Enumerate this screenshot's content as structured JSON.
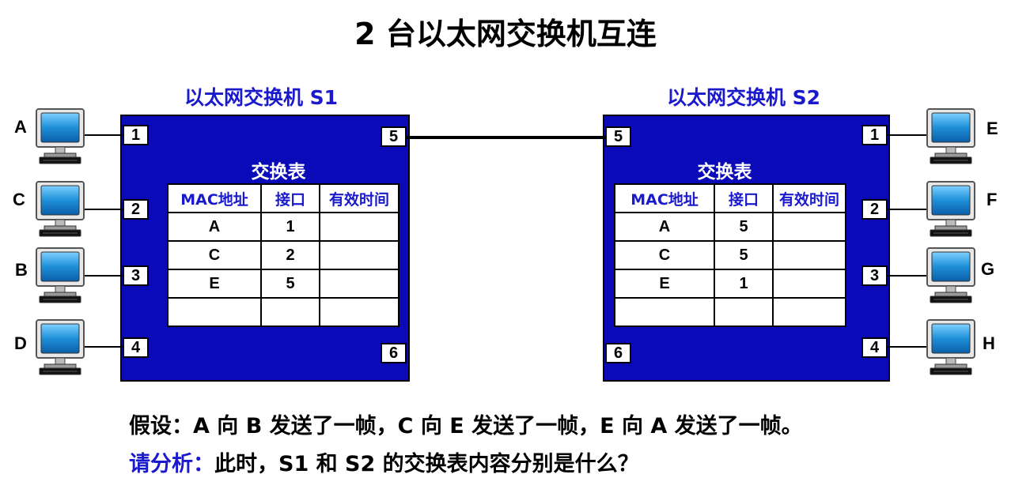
{
  "title": "2 台以太网交换机互连",
  "switch_s1": {
    "name": "以太网交换机 S1",
    "table_title": "交换表",
    "ports": [
      "1",
      "2",
      "3",
      "4",
      "5",
      "6"
    ],
    "headers": [
      "MAC地址",
      "接口",
      "有效时间"
    ],
    "rows": [
      [
        "A",
        "1",
        ""
      ],
      [
        "C",
        "2",
        ""
      ],
      [
        "E",
        "5",
        ""
      ],
      [
        "",
        "",
        ""
      ]
    ]
  },
  "switch_s2": {
    "name": "以太网交换机 S2",
    "table_title": "交换表",
    "ports": [
      "1",
      "2",
      "3",
      "4",
      "5",
      "6"
    ],
    "headers": [
      "MAC地址",
      "接口",
      "有效时间"
    ],
    "rows": [
      [
        "A",
        "5",
        ""
      ],
      [
        "C",
        "5",
        ""
      ],
      [
        "E",
        "1",
        ""
      ],
      [
        "",
        "",
        ""
      ]
    ]
  },
  "hosts_left": [
    "A",
    "C",
    "B",
    "D"
  ],
  "hosts_right": [
    "E",
    "F",
    "G",
    "H"
  ],
  "question": {
    "assumption_label": "假设：",
    "assumption_text": "A 向 B 发送了一帧，C 向 E 发送了一帧，E 向 A 发送了一帧。",
    "analyze_label": "请分析：",
    "analyze_text": "此时，S1 和 S2 的交换表内容分别是什么？"
  },
  "colors": {
    "switch_fill": "#0a0ab8",
    "label_blue": "#1a1acc",
    "monitor_screen": "#1e8fd8"
  },
  "icons": [
    "computer-icon"
  ]
}
